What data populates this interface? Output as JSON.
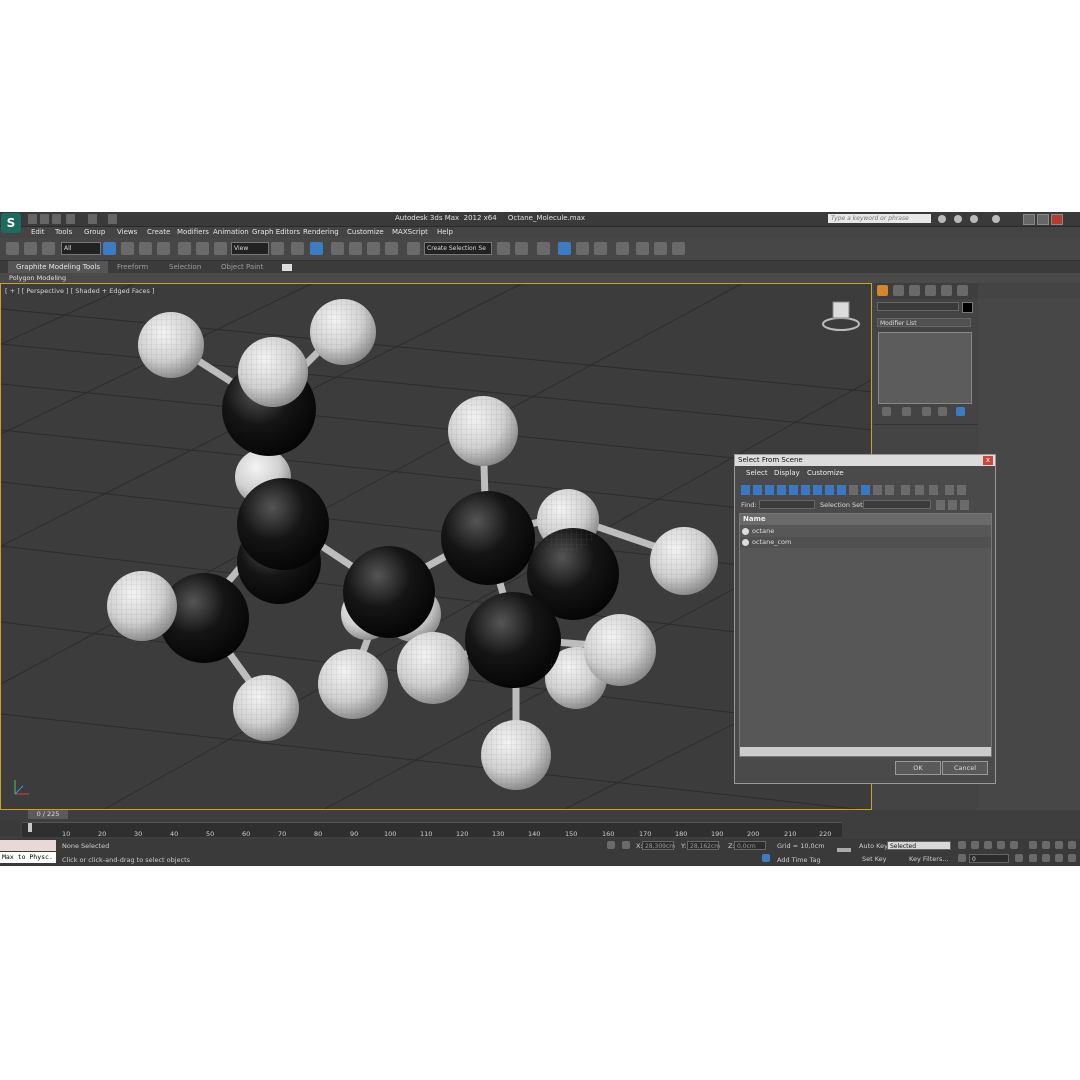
{
  "app": {
    "title": "Autodesk 3ds Max  2012 x64     Octane_Molecule.max",
    "search_placeholder": "Type a keyword or phrase",
    "logo": "S"
  },
  "menu": [
    "Edit",
    "Tools",
    "Group",
    "Views",
    "Create",
    "Modifiers",
    "Animation",
    "Graph Editors",
    "Rendering",
    "Customize",
    "MAXScript",
    "Help"
  ],
  "toolbar": {
    "selection_filter": "All",
    "reference_coord": "View",
    "named_selection": "Create Selection Se"
  },
  "ribbon": {
    "tabs": [
      "Graphite Modeling Tools",
      "Freeform",
      "Selection",
      "Object Paint"
    ],
    "sub_label": "Polygon Modeling"
  },
  "viewport": {
    "label": "[ + ] [ Perspective ] [ Shaded + Edged Faces ]"
  },
  "command_panel": {
    "modifier_list": "Modifier List"
  },
  "dialog": {
    "title": "Select From Scene",
    "close": "x",
    "menus": [
      "Select",
      "Display",
      "Customize"
    ],
    "find_label": "Find:",
    "selection_set_label": "Selection Set:",
    "column_header": "Name",
    "items": [
      "octane",
      "octane_com"
    ],
    "ok": "OK",
    "cancel": "Cancel"
  },
  "timeline": {
    "frame": "0 / 225",
    "ticks": [
      "10",
      "20",
      "30",
      "40",
      "50",
      "60",
      "70",
      "80",
      "90",
      "100",
      "110",
      "120",
      "130",
      "140",
      "150",
      "160",
      "170",
      "180",
      "190",
      "200",
      "210",
      "220"
    ]
  },
  "status": {
    "maxscript": "Max to Physc.",
    "selection": "None Selected",
    "prompt": "Click or click-and-drag to select objects",
    "x_label": "X:",
    "x_value": "28,309cm",
    "y_label": "Y:",
    "y_value": "28,162cm",
    "z_label": "Z:",
    "z_value": "0,0cm",
    "grid": "Grid = 10,0cm",
    "add_time_tag": "Add Time Tag",
    "auto_key": "Auto Key",
    "set_key": "Set Key",
    "key_mode": "Selected",
    "key_filters": "Key Filters...",
    "current_frame": "0"
  }
}
